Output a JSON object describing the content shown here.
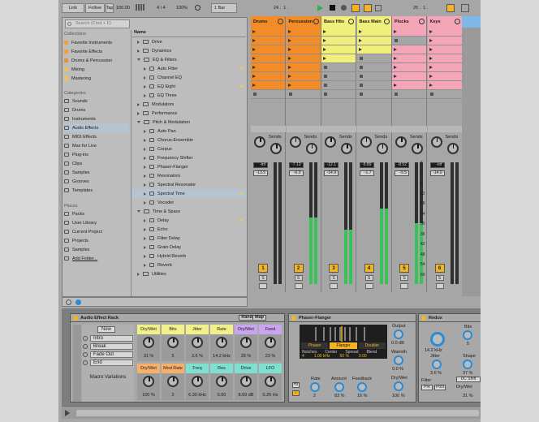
{
  "toolbar": {
    "link": "Link",
    "follow": "Follow",
    "tempo": "100.00",
    "sig": "4 / 4",
    "zoom": "100%",
    "quant": "1 Bar",
    "pos1": "24 .",
    "pos1b": "1 .",
    "pos2": "25 .",
    "pos2b": "1 ."
  },
  "browser": {
    "search_placeholder": "Search (Cmd + F)",
    "collections_title": "Collections",
    "collections": [
      {
        "label": "Favorite Instruments",
        "color": "#f0a030"
      },
      {
        "label": "Favorite Effects",
        "color": "#f0a030"
      },
      {
        "label": "Drums & Percussion",
        "color": "#e9902a"
      },
      {
        "label": "Mixing",
        "color": "#f2c14e"
      },
      {
        "label": "Mastering",
        "color": "#f2c14e"
      }
    ],
    "categories_title": "Categories",
    "categories": [
      "Sounds",
      "Drums",
      "Instruments",
      "Audio Effects",
      "MIDI Effects",
      "Max for Live",
      "Plug-ins",
      "Clips",
      "Samples",
      "Grooves",
      "Templates"
    ],
    "places_title": "Places",
    "places": [
      "Packs",
      "User Library",
      "Current Project",
      "Projects",
      "Samples",
      "Add Folder..."
    ],
    "list_header": "Name",
    "items": [
      "Drive",
      "Dynamics",
      "EQ & Filters",
      "Auto Filter",
      "Channel EQ",
      "EQ Eight",
      "EQ Three",
      "Modulators",
      "Performance",
      "Pitch & Modulation",
      "Auto Pan",
      "Chorus-Ensemble",
      "Corpus",
      "Frequency Shifter",
      "Phaser-Flanger",
      "Resonators",
      "Spectral Resonator",
      "Spectral Time",
      "Vocoder",
      "Time & Space",
      "Delay",
      "Echo",
      "Filter Delay",
      "Grain Delay",
      "Hybrid Reverb",
      "Reverb",
      "Utilities"
    ]
  },
  "tracks": [
    {
      "name": "Drums",
      "color": "#f28c28",
      "num": "1",
      "vol": "-inf",
      "peak": "-13.5",
      "level": 0
    },
    {
      "name": "Percussion",
      "color": "#f28c28",
      "num": "2",
      "vol": "-7.13",
      "peak": "-6.0",
      "level": 0.55
    },
    {
      "name": "Bass Hits",
      "color": "#f1ef7b",
      "num": "3",
      "vol": "-12.1",
      "peak": "-14.9",
      "level": 0.45
    },
    {
      "name": "Bass Main",
      "color": "#f1ef7b",
      "num": "4",
      "vol": "-5.89",
      "peak": "-1.7",
      "level": 0.62
    },
    {
      "name": "Plucks",
      "color": "#f4a6b8",
      "num": "5",
      "vol": "-8.52",
      "peak": "-5.5",
      "level": 0.5
    },
    {
      "name": "Keys",
      "color": "#f4a6b8",
      "num": "6",
      "vol": "-inf",
      "peak": "-14.0",
      "level": 0
    }
  ],
  "sends_label": "Sends",
  "io_labels": [
    "32",
    "32",
    "40",
    "40"
  ],
  "db_scale": [
    "6",
    "0",
    "6",
    "12",
    "18",
    "24",
    "30",
    "36",
    "42",
    "48",
    "54",
    "60"
  ],
  "rack": {
    "title": "Audio Effect Rack",
    "rand": "Rand",
    "map": "Map",
    "new": "New",
    "variations": [
      "Intro",
      "Break",
      "Fade Out",
      "End"
    ],
    "macro_variations": "Macro Variations",
    "macros": [
      {
        "label": "Dry/Wet",
        "value": "31 %",
        "color": "#f2f08a"
      },
      {
        "label": "Bits",
        "value": "5",
        "color": "#f2f08a"
      },
      {
        "label": "Jitter",
        "value": "3.6 %",
        "color": "#f2f08a"
      },
      {
        "label": "Rate",
        "value": "14.2 kHz",
        "color": "#f2f08a"
      },
      {
        "label": "Dry/Wet",
        "value": "28 %",
        "color": "#c9a5f0"
      },
      {
        "label": "Feed",
        "value": "23 %",
        "color": "#c9a5f0"
      },
      {
        "label": "Dry/Wet",
        "value": "100 %",
        "color": "#f7b06a"
      },
      {
        "label": "Mod Rate",
        "value": "2",
        "color": "#f7b06a"
      },
      {
        "label": "Freq",
        "value": "6.30 kHz",
        "color": "#7fe0d0"
      },
      {
        "label": "Res",
        "value": "0.00",
        "color": "#7fe0d0"
      },
      {
        "label": "Drive",
        "value": "8.69 dB",
        "color": "#7fe0d0"
      },
      {
        "label": "LFO",
        "value": "0.26 Hz",
        "color": "#7fe0d0"
      }
    ]
  },
  "phaser": {
    "title": "Phaser-Flanger",
    "modes": [
      "Phaser",
      "Flanger",
      "Doubler"
    ],
    "notches_label": "Notches",
    "notches": "4",
    "center_label": "Center",
    "center": "1.00 kHz",
    "spread_label": "Spread",
    "spread": "50 %",
    "blend_label": "Blend",
    "blend": "0.00",
    "rate_label": "Rate",
    "rate": "2",
    "amount_label": "Amount",
    "amount": "83 %",
    "feedback_label": "Feedback",
    "feedback": "16 %",
    "output_label": "Output",
    "output": "0.0 dB",
    "warmth_label": "Warmth",
    "warmth": "0.0 %",
    "drywet_label": "Dry/Wet",
    "drywet": "100 %",
    "hz": "Hz",
    "sync": "♪"
  },
  "redux": {
    "title": "Redux",
    "bits_label": "Bits",
    "bits": "5",
    "rate": "14.2 kHz",
    "jitter_label": "Jitter",
    "jitter": "3.6 %",
    "shape_label": "Shape",
    "shape": "37 %",
    "filter_label": "Filter",
    "pre": "Pre",
    "post": "Post",
    "dc": "DC Shift",
    "drywet_label": "Dry/Wet",
    "drywet": "31 %"
  }
}
